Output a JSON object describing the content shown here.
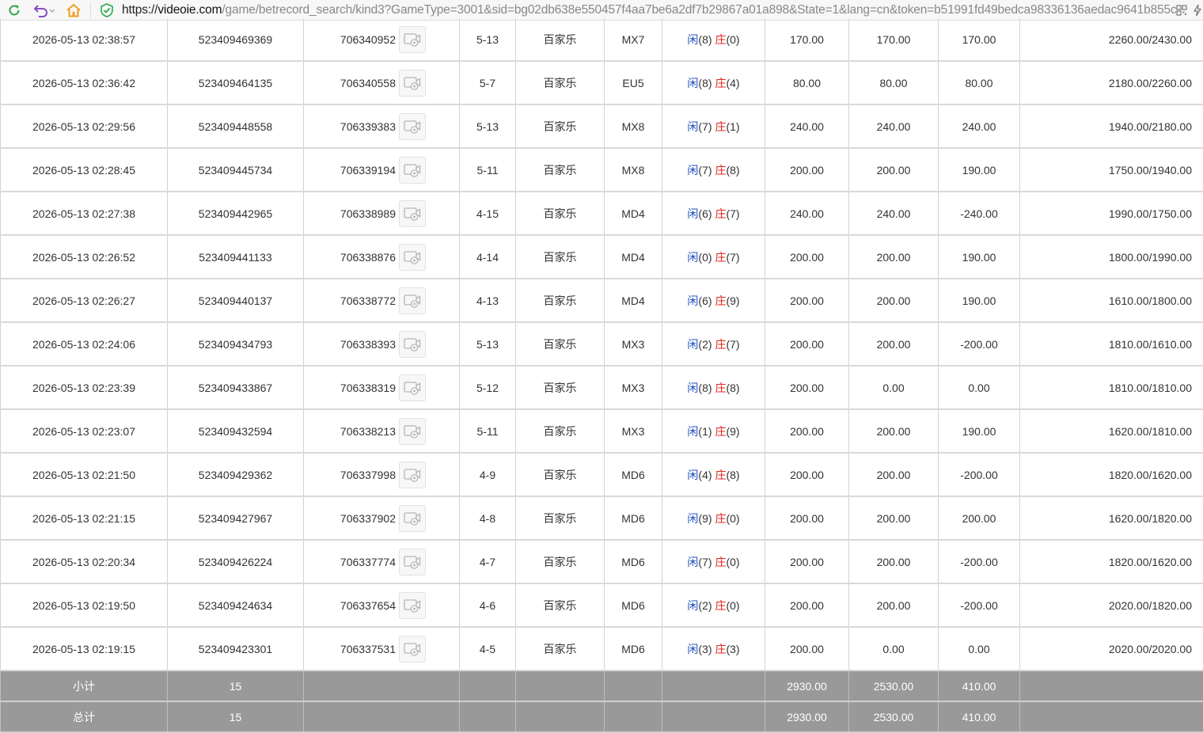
{
  "browser": {
    "url_scheme": "https://",
    "url_host": "videoie.com",
    "url_rest": "/game/betrecord_search/kind3?GameType=3001&sid=bg02db638e550457f4aa7be6a2df7b29867a01a898&State=1&lang=cn&token=b51991fd49bedca98336136aedac9641b855c",
    "icons": [
      "refresh-icon",
      "undo-icon",
      "home-icon",
      "shield-check-icon",
      "qr-code-icon",
      "lightning-icon"
    ]
  },
  "colors": {
    "positive": "#1f5fc4",
    "negative": "#e0241c",
    "summary_bg": "#999999"
  },
  "rows": [
    {
      "time": "2026-05-13 02:38:57",
      "bet_id": "523409469369",
      "round_id": "706340952",
      "shoe": "5-13",
      "game": "百家乐",
      "table": "MX7",
      "player_label": "闲",
      "player_score": "(8)",
      "banker_label": "庄",
      "banker_score": "(0)",
      "bet": "170.00",
      "valid": "170.00",
      "payout": "170.00",
      "payout_negative": false,
      "balance": "2260.00/2430.00"
    },
    {
      "time": "2026-05-13 02:36:42",
      "bet_id": "523409464135",
      "round_id": "706340558",
      "shoe": "5-7",
      "game": "百家乐",
      "table": "EU5",
      "player_label": "闲",
      "player_score": "(8)",
      "banker_label": "庄",
      "banker_score": "(4)",
      "bet": "80.00",
      "valid": "80.00",
      "payout": "80.00",
      "payout_negative": false,
      "balance": "2180.00/2260.00"
    },
    {
      "time": "2026-05-13 02:29:56",
      "bet_id": "523409448558",
      "round_id": "706339383",
      "shoe": "5-13",
      "game": "百家乐",
      "table": "MX8",
      "player_label": "闲",
      "player_score": "(7)",
      "banker_label": "庄",
      "banker_score": "(1)",
      "bet": "240.00",
      "valid": "240.00",
      "payout": "240.00",
      "payout_negative": false,
      "balance": "1940.00/2180.00"
    },
    {
      "time": "2026-05-13 02:28:45",
      "bet_id": "523409445734",
      "round_id": "706339194",
      "shoe": "5-11",
      "game": "百家乐",
      "table": "MX8",
      "player_label": "闲",
      "player_score": "(7)",
      "banker_label": "庄",
      "banker_score": "(8)",
      "bet": "200.00",
      "valid": "200.00",
      "payout": "190.00",
      "payout_negative": false,
      "balance": "1750.00/1940.00"
    },
    {
      "time": "2026-05-13 02:27:38",
      "bet_id": "523409442965",
      "round_id": "706338989",
      "shoe": "4-15",
      "game": "百家乐",
      "table": "MD4",
      "player_label": "闲",
      "player_score": "(6)",
      "banker_label": "庄",
      "banker_score": "(7)",
      "bet": "240.00",
      "valid": "240.00",
      "payout": "-240.00",
      "payout_negative": true,
      "balance": "1990.00/1750.00"
    },
    {
      "time": "2026-05-13 02:26:52",
      "bet_id": "523409441133",
      "round_id": "706338876",
      "shoe": "4-14",
      "game": "百家乐",
      "table": "MD4",
      "player_label": "闲",
      "player_score": "(0)",
      "banker_label": "庄",
      "banker_score": "(7)",
      "bet": "200.00",
      "valid": "200.00",
      "payout": "190.00",
      "payout_negative": false,
      "balance": "1800.00/1990.00"
    },
    {
      "time": "2026-05-13 02:26:27",
      "bet_id": "523409440137",
      "round_id": "706338772",
      "shoe": "4-13",
      "game": "百家乐",
      "table": "MD4",
      "player_label": "闲",
      "player_score": "(6)",
      "banker_label": "庄",
      "banker_score": "(9)",
      "bet": "200.00",
      "valid": "200.00",
      "payout": "190.00",
      "payout_negative": false,
      "balance": "1610.00/1800.00"
    },
    {
      "time": "2026-05-13 02:24:06",
      "bet_id": "523409434793",
      "round_id": "706338393",
      "shoe": "5-13",
      "game": "百家乐",
      "table": "MX3",
      "player_label": "闲",
      "player_score": "(2)",
      "banker_label": "庄",
      "banker_score": "(7)",
      "bet": "200.00",
      "valid": "200.00",
      "payout": "-200.00",
      "payout_negative": true,
      "balance": "1810.00/1610.00"
    },
    {
      "time": "2026-05-13 02:23:39",
      "bet_id": "523409433867",
      "round_id": "706338319",
      "shoe": "5-12",
      "game": "百家乐",
      "table": "MX3",
      "player_label": "闲",
      "player_score": "(8)",
      "banker_label": "庄",
      "banker_score": "(8)",
      "bet": "200.00",
      "valid": "0.00",
      "payout": "0.00",
      "payout_negative": false,
      "balance": "1810.00/1810.00"
    },
    {
      "time": "2026-05-13 02:23:07",
      "bet_id": "523409432594",
      "round_id": "706338213",
      "shoe": "5-11",
      "game": "百家乐",
      "table": "MX3",
      "player_label": "闲",
      "player_score": "(1)",
      "banker_label": "庄",
      "banker_score": "(9)",
      "bet": "200.00",
      "valid": "200.00",
      "payout": "190.00",
      "payout_negative": false,
      "balance": "1620.00/1810.00"
    },
    {
      "time": "2026-05-13 02:21:50",
      "bet_id": "523409429362",
      "round_id": "706337998",
      "shoe": "4-9",
      "game": "百家乐",
      "table": "MD6",
      "player_label": "闲",
      "player_score": "(4)",
      "banker_label": "庄",
      "banker_score": "(8)",
      "bet": "200.00",
      "valid": "200.00",
      "payout": "-200.00",
      "payout_negative": true,
      "balance": "1820.00/1620.00"
    },
    {
      "time": "2026-05-13 02:21:15",
      "bet_id": "523409427967",
      "round_id": "706337902",
      "shoe": "4-8",
      "game": "百家乐",
      "table": "MD6",
      "player_label": "闲",
      "player_score": "(9)",
      "banker_label": "庄",
      "banker_score": "(0)",
      "bet": "200.00",
      "valid": "200.00",
      "payout": "200.00",
      "payout_negative": false,
      "balance": "1620.00/1820.00"
    },
    {
      "time": "2026-05-13 02:20:34",
      "bet_id": "523409426224",
      "round_id": "706337774",
      "shoe": "4-7",
      "game": "百家乐",
      "table": "MD6",
      "player_label": "闲",
      "player_score": "(7)",
      "banker_label": "庄",
      "banker_score": "(0)",
      "bet": "200.00",
      "valid": "200.00",
      "payout": "-200.00",
      "payout_negative": true,
      "balance": "1820.00/1620.00"
    },
    {
      "time": "2026-05-13 02:19:50",
      "bet_id": "523409424634",
      "round_id": "706337654",
      "shoe": "4-6",
      "game": "百家乐",
      "table": "MD6",
      "player_label": "闲",
      "player_score": "(2)",
      "banker_label": "庄",
      "banker_score": "(0)",
      "bet": "200.00",
      "valid": "200.00",
      "payout": "-200.00",
      "payout_negative": true,
      "balance": "2020.00/1820.00"
    },
    {
      "time": "2026-05-13 02:19:15",
      "bet_id": "523409423301",
      "round_id": "706337531",
      "shoe": "4-5",
      "game": "百家乐",
      "table": "MD6",
      "player_label": "闲",
      "player_score": "(3)",
      "banker_label": "庄",
      "banker_score": "(3)",
      "bet": "200.00",
      "valid": "0.00",
      "payout": "0.00",
      "payout_negative": false,
      "balance": "2020.00/2020.00"
    }
  ],
  "subtotal": {
    "label": "小计",
    "count": "15",
    "bet": "2930.00",
    "valid": "2530.00",
    "payout": "410.00"
  },
  "total": {
    "label": "总计",
    "count": "15",
    "bet": "2930.00",
    "valid": "2530.00",
    "payout": "410.00"
  }
}
